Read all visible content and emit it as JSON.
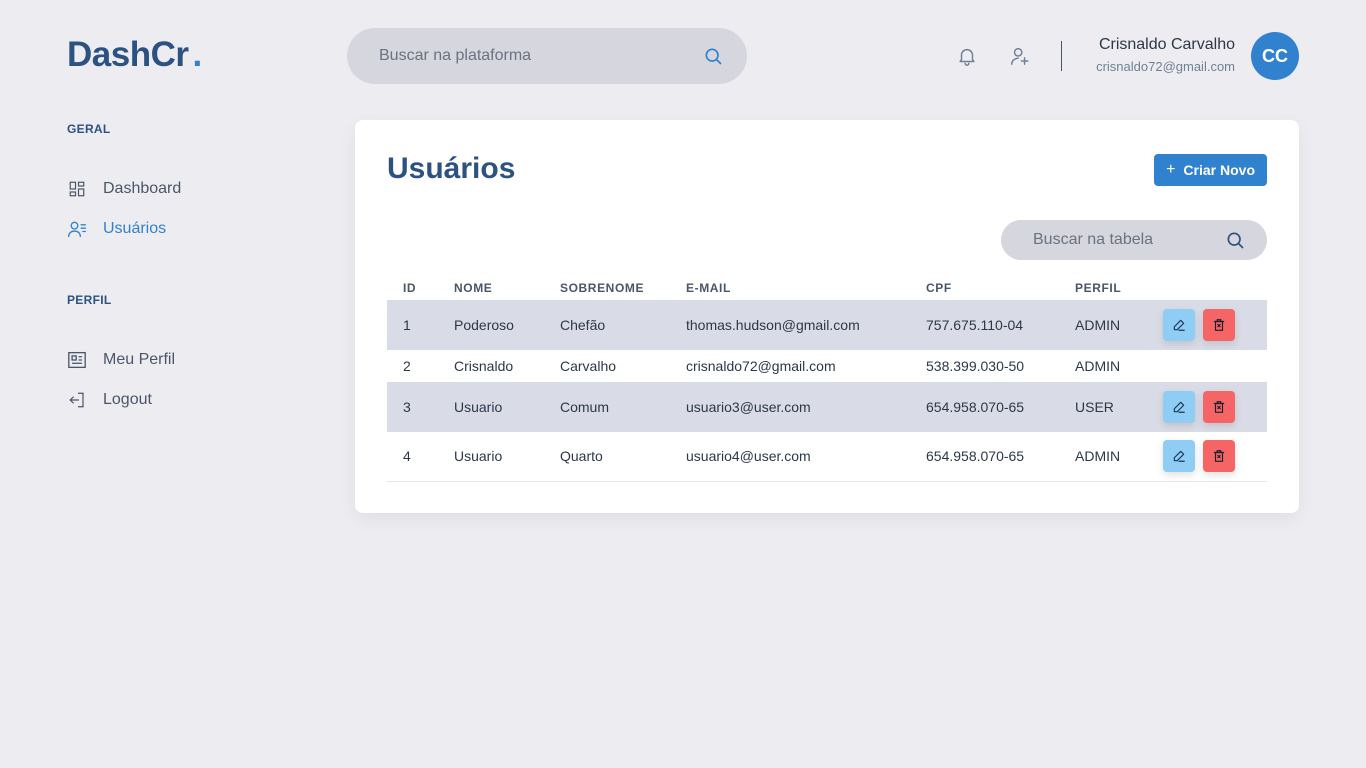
{
  "brand": {
    "name": "DashCr",
    "dot": "."
  },
  "header": {
    "search_placeholder": "Buscar na plataforma",
    "user_name": "Crisnaldo Carvalho",
    "user_email": "crisnaldo72@gmail.com",
    "avatar_initials": "CC"
  },
  "sidebar": {
    "sections": [
      {
        "title": "GERAL",
        "items": [
          {
            "label": "Dashboard",
            "icon": "dashboard-icon",
            "active": false
          },
          {
            "label": "Usuários",
            "icon": "users-icon",
            "active": true
          }
        ]
      },
      {
        "title": "PERFIL",
        "items": [
          {
            "label": "Meu Perfil",
            "icon": "profile-icon",
            "active": false
          },
          {
            "label": "Logout",
            "icon": "logout-icon",
            "active": false
          }
        ]
      }
    ]
  },
  "main": {
    "title": "Usuários",
    "create_button": "Criar Novo",
    "table_search_placeholder": "Buscar na tabela",
    "table": {
      "columns": [
        "ID",
        "NOME",
        "SOBRENOME",
        "E-MAIL",
        "CPF",
        "PERFIL"
      ],
      "rows": [
        {
          "id": "1",
          "nome": "Poderoso",
          "sobrenome": "Chefão",
          "email": "thomas.hudson@gmail.com",
          "cpf": "757.675.110-04",
          "perfil": "ADMIN",
          "actions": true
        },
        {
          "id": "2",
          "nome": "Crisnaldo",
          "sobrenome": "Carvalho",
          "email": "crisnaldo72@gmail.com",
          "cpf": "538.399.030-50",
          "perfil": "ADMIN",
          "actions": false
        },
        {
          "id": "3",
          "nome": "Usuario",
          "sobrenome": "Comum",
          "email": "usuario3@user.com",
          "cpf": "654.958.070-65",
          "perfil": "USER",
          "actions": true
        },
        {
          "id": "4",
          "nome": "Usuario",
          "sobrenome": "Quarto",
          "email": "usuario4@user.com",
          "cpf": "654.958.070-65",
          "perfil": "ADMIN",
          "actions": true
        }
      ]
    }
  },
  "colors": {
    "background": "#ededf1",
    "brand": "#2c5282",
    "accent": "#3182ce",
    "edit": "#90cdf4",
    "delete": "#f56565",
    "row_shade": "#d9dce6"
  }
}
